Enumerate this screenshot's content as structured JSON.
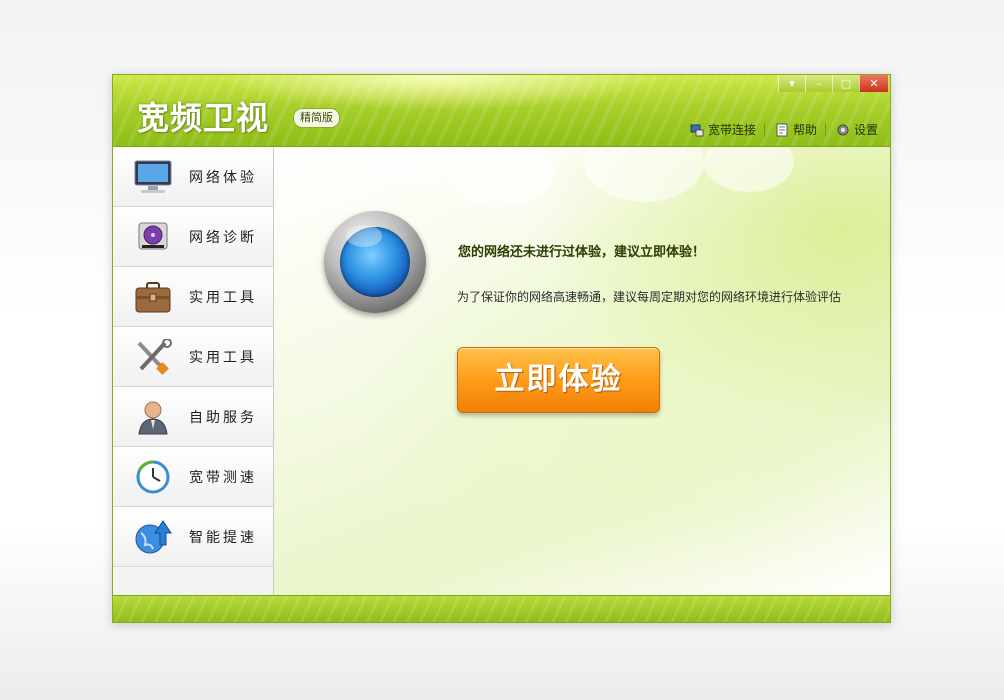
{
  "app": {
    "title": "宽频卫视",
    "edition": "精简版"
  },
  "window_controls": {
    "menu": "▾",
    "minimize": "–",
    "maximize": "□",
    "close": "✕"
  },
  "toplinks": [
    {
      "label": "宽带连接",
      "icon": "network-connection-icon"
    },
    {
      "label": "帮助",
      "icon": "help-document-icon"
    },
    {
      "label": "设置",
      "icon": "gear-icon"
    }
  ],
  "sidebar": {
    "items": [
      {
        "label": "网络体验",
        "icon": "monitor-icon"
      },
      {
        "label": "网络诊断",
        "icon": "disk-diagnosis-icon"
      },
      {
        "label": "实用工具",
        "icon": "briefcase-icon"
      },
      {
        "label": "实用工具",
        "icon": "tools-icon"
      },
      {
        "label": "自助服务",
        "icon": "user-service-icon"
      },
      {
        "label": "宽带测速",
        "icon": "clock-speed-icon"
      },
      {
        "label": "智能提速",
        "icon": "globe-up-arrow-icon"
      }
    ]
  },
  "main": {
    "headline": "您的网络还未进行过体验，建议立即体验！",
    "subtext": "为了保证你的网络高速畅通，建议每周定期对您的网络环境进行体验评估",
    "cta_label": "立即体验"
  },
  "colors": {
    "brand_green": "#a9cf2a",
    "cta_orange": "#ff9d1a",
    "close_red": "#c8321c"
  }
}
